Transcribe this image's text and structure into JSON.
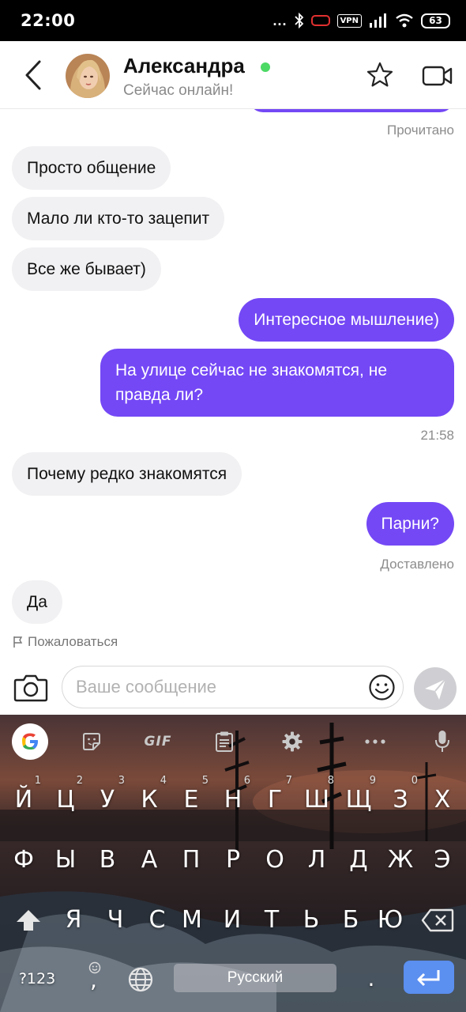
{
  "status_bar": {
    "time": "22:00",
    "dots": "...",
    "vpn": "VPN",
    "battery": "63"
  },
  "header": {
    "contact_name": "Александра",
    "contact_status": "Сейчас онлайн!"
  },
  "messages": {
    "read_receipt": "Прочитано",
    "m1": "Просто общение",
    "m2": "Мало ли кто-то зацепит",
    "m3": "Все же бывает)",
    "m4": "Интересное мышление)",
    "m5": "На улице сейчас не знакомятся, не правда ли?",
    "time_1": "21:58",
    "m6": "Почему редко знакомятся",
    "m7": "Парни?",
    "delivered": "Доставлено",
    "m8": "Да"
  },
  "report_label": "Пожаловаться",
  "input": {
    "placeholder": "Ваше сообщение",
    "value": ""
  },
  "keyboard": {
    "gif_label": "GIF",
    "row1": [
      "Й",
      "Ц",
      "У",
      "К",
      "Е",
      "Н",
      "Г",
      "Ш",
      "Щ",
      "З",
      "Х"
    ],
    "row1_hints": [
      "1",
      "2",
      "3",
      "4",
      "5",
      "6",
      "7",
      "8",
      "9",
      "0",
      ""
    ],
    "row2": [
      "Ф",
      "Ы",
      "В",
      "А",
      "П",
      "Р",
      "О",
      "Л",
      "Д",
      "Ж",
      "Э"
    ],
    "row3": [
      "Я",
      "Ч",
      "С",
      "М",
      "И",
      "Т",
      "Ь",
      "Б",
      "Ю"
    ],
    "symbols_label": "?123",
    "comma": ",",
    "space_label": "Русский",
    "period": "."
  },
  "colors": {
    "outgoing_bubble": "#7448f5",
    "incoming_bubble": "#f1f1f3",
    "online": "#4cd964",
    "enter_key": "#5b8ff0"
  },
  "icons": [
    "back-arrow-icon",
    "star-icon",
    "video-call-icon",
    "camera-icon",
    "emoji-icon",
    "send-icon",
    "flag-icon",
    "google-icon",
    "sticker-icon",
    "clipboard-icon",
    "settings-gear-icon",
    "more-icon",
    "mic-icon",
    "backspace-icon",
    "shift-icon",
    "globe-icon",
    "enter-icon"
  ]
}
